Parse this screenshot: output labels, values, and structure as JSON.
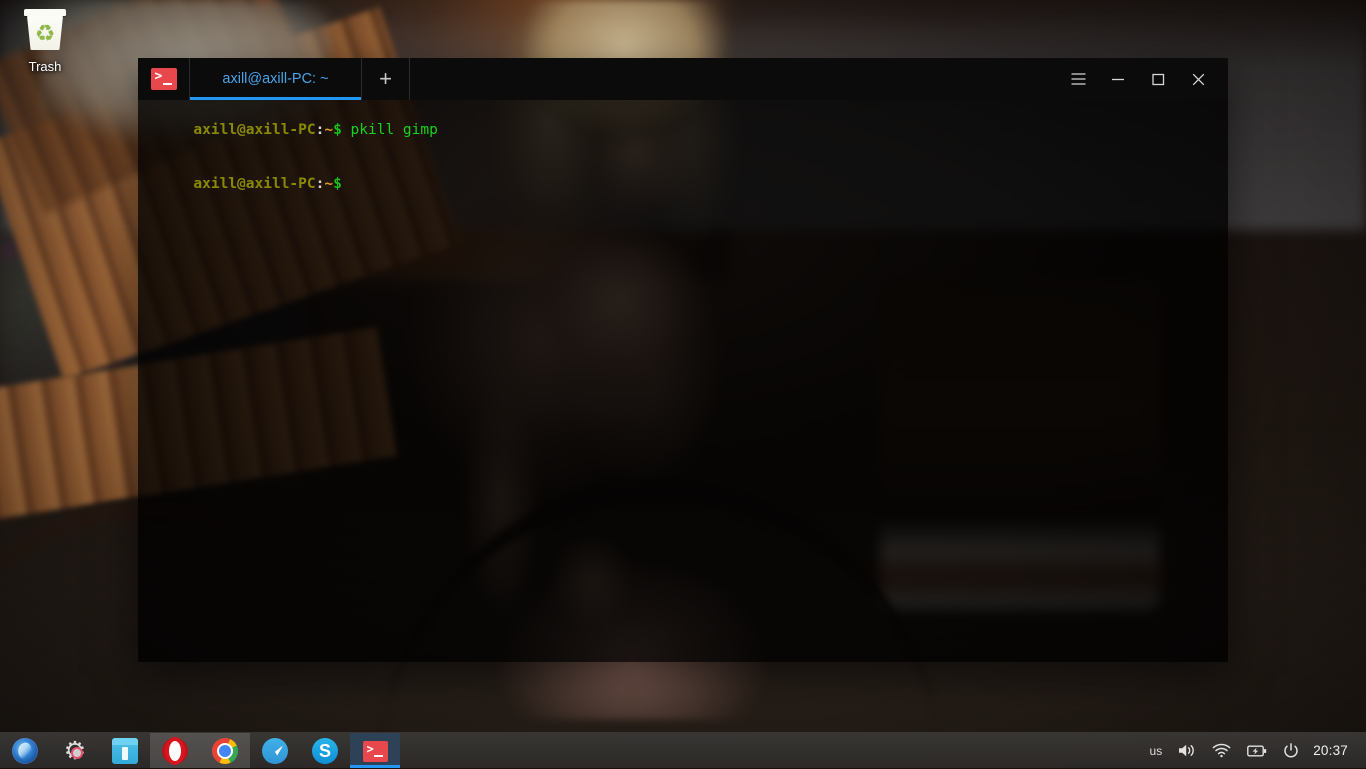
{
  "desktop": {
    "icons": [
      {
        "label": "Trash",
        "icon": "trash-icon"
      }
    ]
  },
  "terminal": {
    "app_icon": "terminal-icon",
    "tabs": [
      {
        "label": "axill@axill-PC: ~",
        "active": true
      }
    ],
    "new_tab_label": "+",
    "window_controls": [
      {
        "name": "menu-button",
        "icon": "hamburger-icon"
      },
      {
        "name": "minimize-button",
        "icon": "minimize-icon"
      },
      {
        "name": "maximize-button",
        "icon": "maximize-icon"
      },
      {
        "name": "close-button",
        "icon": "close-icon"
      }
    ],
    "lines": [
      {
        "user": "axill@axill-PC",
        "colon": ":",
        "path": "~",
        "dollar": "$",
        "command": " pkill gimp"
      },
      {
        "user": "axill@axill-PC",
        "colon": ":",
        "path": "~",
        "dollar": "$",
        "command": ""
      }
    ],
    "colors": {
      "tab_text": "#4aa3e8",
      "tab_underline": "#2196f3",
      "prompt_user": "#8a8a00",
      "prompt_path": "#d89a2a",
      "prompt_dollar": "#18c018",
      "command_text": "#19d219",
      "app_icon_bg": "#e8484c"
    }
  },
  "taskbar": {
    "launchers": [
      {
        "name": "app-menu-button",
        "icon": "swirl-icon",
        "state": "normal"
      },
      {
        "name": "settings-button",
        "icon": "gear-icon",
        "state": "normal"
      },
      {
        "name": "file-manager-button",
        "icon": "files-icon",
        "state": "normal"
      },
      {
        "name": "opera-button",
        "icon": "opera-icon",
        "state": "hover"
      },
      {
        "name": "chrome-button",
        "icon": "chrome-icon",
        "state": "hover"
      },
      {
        "name": "telegram-button",
        "icon": "telegram-icon",
        "state": "normal"
      },
      {
        "name": "skype-button",
        "icon": "skype-icon",
        "state": "normal"
      },
      {
        "name": "terminal-window-button",
        "icon": "terminal-icon",
        "state": "active"
      }
    ],
    "tray": {
      "keyboard_layout": "us",
      "volume_icon": "volume-icon",
      "network_icon": "wifi-icon",
      "battery_icon": "battery-icon",
      "power_icon": "power-icon",
      "clock": "20:37"
    },
    "accent_color": "#2196f3",
    "active_bg": "#2e4257"
  }
}
